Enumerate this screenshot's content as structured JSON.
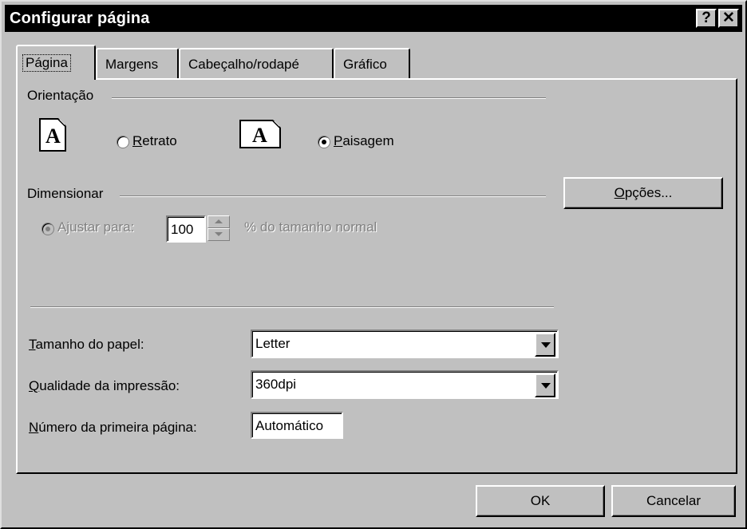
{
  "window": {
    "title": "Configurar página",
    "help_glyph": "?",
    "close_glyph": "✕"
  },
  "tabs": [
    {
      "label": "Página"
    },
    {
      "label": "Margens"
    },
    {
      "label": "Cabeçalho/rodapé"
    },
    {
      "label": "Gráfico"
    }
  ],
  "orientation": {
    "group_label": "Orientação",
    "portrait_label": "Retrato",
    "landscape_label": "Paisagem",
    "icon_letter": "A",
    "selected": "landscape"
  },
  "scaling": {
    "group_label": "Dimensionar",
    "adjust_label": "Ajustar para:",
    "value": "100",
    "suffix": "% do tamanho normal"
  },
  "options_button": "Opções...",
  "paper_size": {
    "label": "Tamanho do papel:",
    "value": "Letter"
  },
  "print_quality": {
    "label": "Qualidade da impressão:",
    "value": "360dpi"
  },
  "first_page": {
    "label": "Número da primeira página:",
    "value": "Automático"
  },
  "footer": {
    "ok": "OK",
    "cancel": "Cancelar"
  }
}
